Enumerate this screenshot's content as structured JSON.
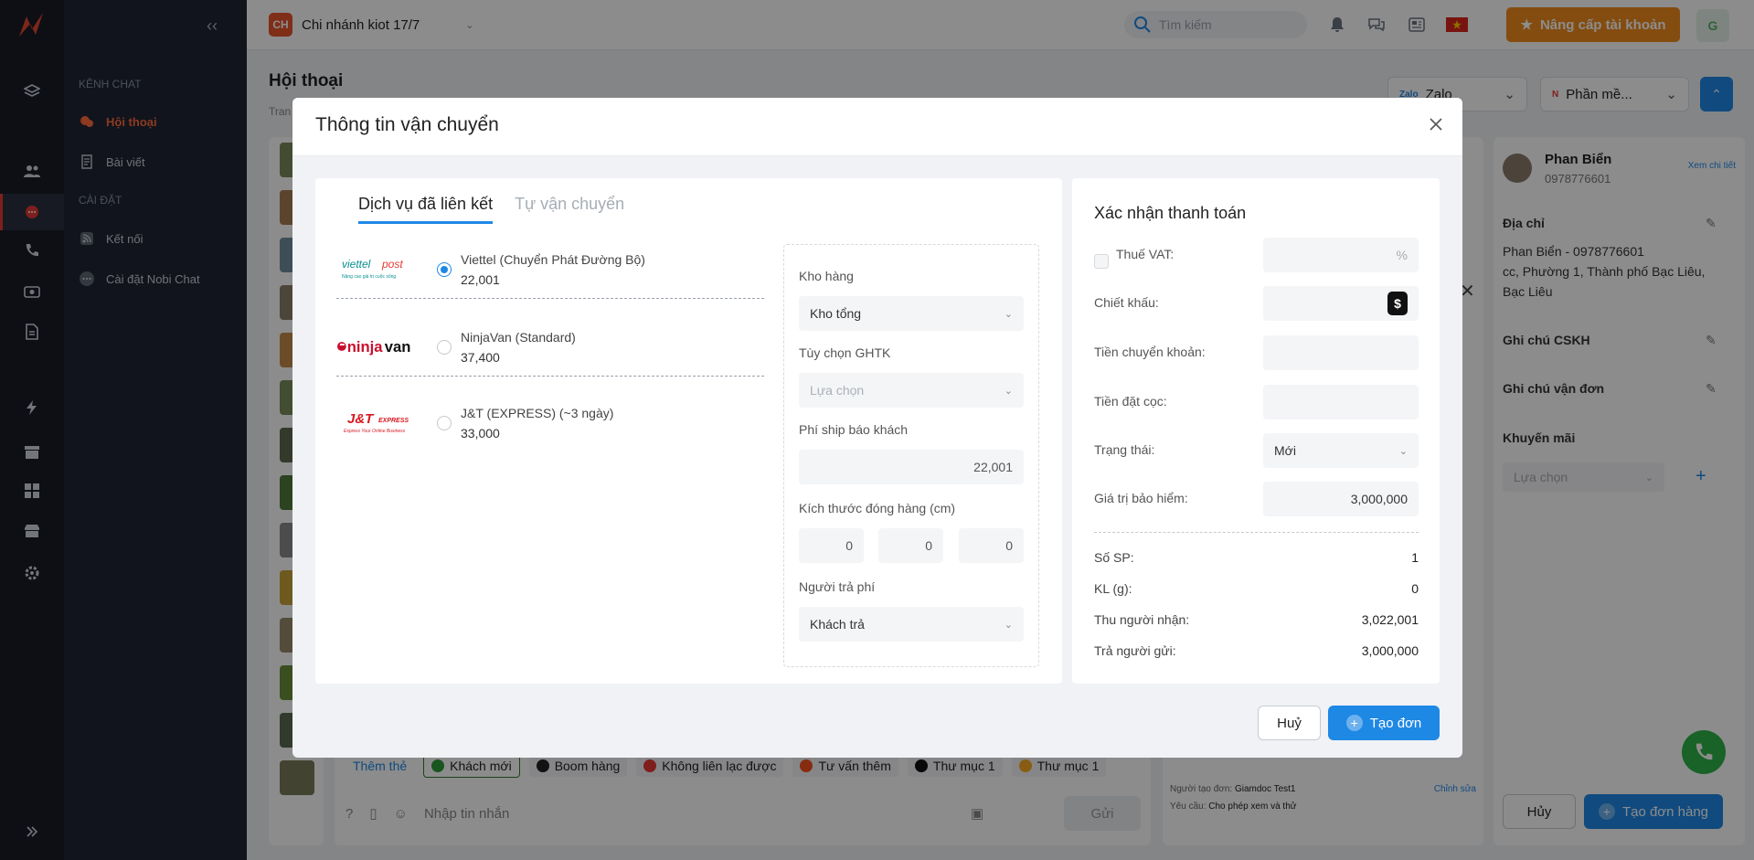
{
  "topbar": {
    "branch_badge": "CH",
    "branch_name": "Chi nhánh kiot 17/7",
    "search_placeholder": "Tìm kiếm",
    "upgrade_label": "Nâng cấp tài khoản",
    "user_initial": "G"
  },
  "sidebar": {
    "section_chat": "KÊNH CHAT",
    "item_conversations": "Hội thoại",
    "item_posts": "Bài viết",
    "section_settings": "CÀI ĐẶT",
    "item_connect": "Kết nối",
    "item_nobi_settings": "Cài đặt Nobi Chat"
  },
  "page": {
    "title": "Hội thoại",
    "breadcrumb": "Tran",
    "channel_select": "Zalo",
    "app_select": "Phần mề..."
  },
  "chat": {
    "add_tag": "Thêm thẻ",
    "tags": [
      {
        "label": "Khách mới",
        "color": "#2e9d3a"
      },
      {
        "label": "Boom hàng",
        "color": "#222222"
      },
      {
        "label": "Không liên lạc được",
        "color": "#e53935"
      },
      {
        "label": "Tư vấn thêm",
        "color": "#f4511e"
      },
      {
        "label": "Thư mục 1",
        "color": "#111111"
      },
      {
        "label": "Thư mục 1",
        "color": "#f9a825"
      }
    ],
    "message_placeholder": "Nhập tin nhắn",
    "send_label": "Gửi"
  },
  "order_panel": {
    "creator_label": "Người tạo đơn:",
    "creator_value": "Giamdoc Test1",
    "edit_link": "Chỉnh sửa",
    "request_label": "Yêu cầu:",
    "request_value": "Cho phép xem và thử"
  },
  "customer": {
    "name": "Phan Biển",
    "phone": "0978776601",
    "view_detail": "Xem chi tiết",
    "address_title": "Địa chỉ",
    "address_line1": "Phan Biển - 0978776601",
    "address_line2": "cc, Phường 1, Thành phố Bạc Liêu,",
    "address_line3": "Bạc Liêu",
    "note_cskh": "Ghi chú CSKH",
    "note_shipping": "Ghi chú vận đơn",
    "promo_title": "Khuyến mãi",
    "promo_placeholder": "Lựa chọn",
    "cancel_label": "Hủy",
    "create_order_label": "Tạo đơn hàng"
  },
  "modal": {
    "title": "Thông tin vận chuyển",
    "tabs": [
      "Dịch vụ đã liên kết",
      "Tự vận chuyển"
    ],
    "carriers": [
      {
        "name": "Viettel (Chuyển Phát Đường Bộ)",
        "price": "22,001",
        "selected": true,
        "logo": "viettelpost"
      },
      {
        "name": "NinjaVan (Standard)",
        "price": "37,400",
        "selected": false,
        "logo": "ninjavan"
      },
      {
        "name": "J&T (EXPRESS) (~3 ngày)",
        "price": "33,000",
        "selected": false,
        "logo": "jt-express"
      }
    ],
    "logos": {
      "viettel_line1": "viettel",
      "viettel_line2": "post",
      "viettel_tagline": "Nâng cao giá trị cuộc sống",
      "ninja_prefix": "ninja",
      "ninja_suffix": "van",
      "jt_main": "J&T",
      "jt_express": "EXPRESS",
      "jt_tagline": "Express Your Online Business"
    },
    "options": {
      "warehouse_label": "Kho hàng",
      "warehouse_value": "Kho tổng",
      "ghtk_label": "Tùy chọn GHTK",
      "ghtk_placeholder": "Lựa chọn",
      "ship_fee_label": "Phí ship báo khách",
      "ship_fee_value": "22,001",
      "size_label": "Kích thước đóng hàng (cm)",
      "size_values": [
        "0",
        "0",
        "0"
      ],
      "payer_label": "Người trả phí",
      "payer_value": "Khách trả"
    },
    "payment": {
      "title": "Xác nhận thanh toán",
      "vat_label": "Thuế VAT:",
      "vat_unit": "%",
      "discount_label": "Chiết khấu:",
      "discount_icon": "$",
      "transfer_label": "Tiền chuyển khoản:",
      "deposit_label": "Tiền đặt cọc:",
      "status_label": "Trạng thái:",
      "status_value": "Mới",
      "insurance_label": "Giá trị bảo hiểm:",
      "insurance_value": "3,000,000",
      "summary": [
        {
          "label": "Số SP:",
          "value": "1"
        },
        {
          "label": "KL (g):",
          "value": "0"
        },
        {
          "label": "Thu người nhận:",
          "value": "3,022,001"
        },
        {
          "label": "Trả người gửi:",
          "value": "3,000,000"
        }
      ]
    },
    "cancel_label": "Huỷ",
    "create_label": "Tạo đơn"
  },
  "colors": {
    "primary": "#1e88e5",
    "upgrade": "#f08a1c",
    "sidebar_bg": "#1f2533",
    "rail_bg": "#181d27",
    "active_nav": "#ff6b3d"
  }
}
